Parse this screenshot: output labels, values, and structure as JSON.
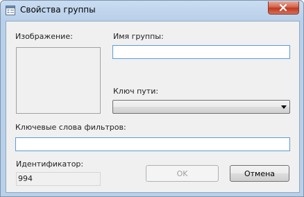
{
  "window": {
    "title": "Свойства группы",
    "app_icon": "window-properties-icon",
    "close_icon": "close-icon"
  },
  "form": {
    "image_label": "Изображение:",
    "group_name_label": "Имя группы:",
    "group_name_value": "",
    "path_key_label": "Ключ пути:",
    "path_key_value": "",
    "filter_keywords_label": "Ключевые слова фильтров:",
    "filter_keywords_value": "",
    "identifier_label": "Идентификатор:",
    "identifier_value": "994"
  },
  "buttons": {
    "ok_label": "OK",
    "cancel_label": "Отмена"
  },
  "colors": {
    "frame_accent": "#b9d0ea",
    "close_button": "#c2381d",
    "focused_border": "#5b9bd5"
  }
}
